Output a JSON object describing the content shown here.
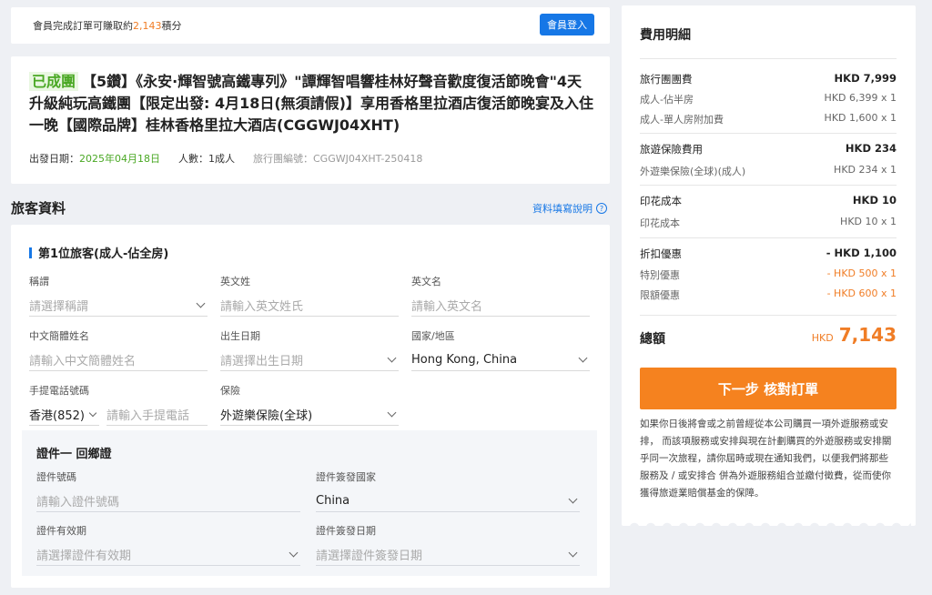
{
  "member_bar": {
    "text_before": "會員完成訂單可賺取約",
    "points": "2,143",
    "text_after": "積分",
    "login_label": "會員登入"
  },
  "tour": {
    "status": "已成團",
    "title": "【5鑽】《永安·輝智號高鐵專列》\"譚輝智唱響桂林好聲音歡度復活節晚會\"4天升級純玩高鐵團【限定出發: 4月18日(無須請假)】享用香格里拉酒店復活節晚宴及入住一晚【國際品牌】桂林香格里拉大酒店(CGGWJ04XHT)",
    "depart_label": "出發日期：",
    "depart_date": "2025年04月18日",
    "people": "人數：1成人",
    "tour_code": "旅行團編號：CGGWJ04XHT-250418"
  },
  "traveler_section": {
    "title": "旅客資料",
    "help_link": "資料填寫說明",
    "traveler_title": "第1位旅客(成人-佔全房)",
    "fields": {
      "salutation": {
        "label": "稱謂",
        "placeholder": "請選擇稱謂"
      },
      "en_surname": {
        "label": "英文姓",
        "placeholder": "請輸入英文姓氏"
      },
      "en_given": {
        "label": "英文名",
        "placeholder": "請輸入英文名"
      },
      "cn_name": {
        "label": "中文簡體姓名",
        "placeholder": "請輸入中文簡體姓名"
      },
      "dob": {
        "label": "出生日期",
        "placeholder": "請選擇出生日期"
      },
      "country": {
        "label": "國家/地區",
        "value": "Hong Kong, China"
      },
      "phone": {
        "label": "手提電話號碼",
        "code": "香港(852)",
        "placeholder": "請輸入手提電話"
      },
      "insurance": {
        "label": "保險",
        "value": "外遊樂保險(全球)"
      }
    },
    "certificate": {
      "title": "證件一 回鄉證",
      "number": {
        "label": "證件號碼",
        "placeholder": "請輸入證件號碼"
      },
      "issue_country": {
        "label": "證件簽發國家",
        "value": "China"
      },
      "validity": {
        "label": "證件有效期",
        "placeholder": "請選擇證件有效期"
      },
      "issue_date": {
        "label": "證件簽發日期",
        "placeholder": "請選擇證件簽發日期"
      }
    }
  },
  "fees": {
    "title": "費用明細",
    "groups": [
      {
        "label": "旅行團團費",
        "amount": "HKD 7,999",
        "items": [
          {
            "label": "成人-佔半房",
            "amount": "HKD 6,399 x 1"
          },
          {
            "label": "成人-單人房附加費",
            "amount": "HKD 1,600 x 1"
          }
        ]
      },
      {
        "label": "旅遊保險費用",
        "amount": "HKD 234",
        "items": [
          {
            "label": "外遊樂保險(全球)(成人)",
            "amount": "HKD 234 x 1"
          }
        ]
      },
      {
        "label": "印花成本",
        "amount": "HKD 10",
        "items": [
          {
            "label": "印花成本",
            "amount": "HKD 10 x 1"
          }
        ]
      },
      {
        "label": "折扣優惠",
        "amount": "- HKD 1,100",
        "items": [
          {
            "label": "特別優惠",
            "amount": "- HKD 500 x 1"
          },
          {
            "label": "限額優惠",
            "amount": "- HKD 600 x 1"
          }
        ]
      }
    ],
    "total_label": "總額",
    "total_currency": "HKD",
    "total_value": "7,143",
    "next_button": "下一步 核對訂單",
    "note": "如果你日後將會或之前曾經從本公司購買一項外遊服務或安排， 而該項服務或安排與現在計劃購買的外遊服務或安排關乎同一次旅程，請你屆時或現在通知我們，以便我們將那些服務及 / 或安排合 併為外遊服務組合並繳付徵費，從而使你獲得旅遊業賠償基金的保障。"
  },
  "colors": {
    "accent_blue": "#1677e6",
    "accent_orange": "#f5821f",
    "green": "#4aa824"
  },
  "icons": [
    "help-icon",
    "chevron-down-icon"
  ]
}
